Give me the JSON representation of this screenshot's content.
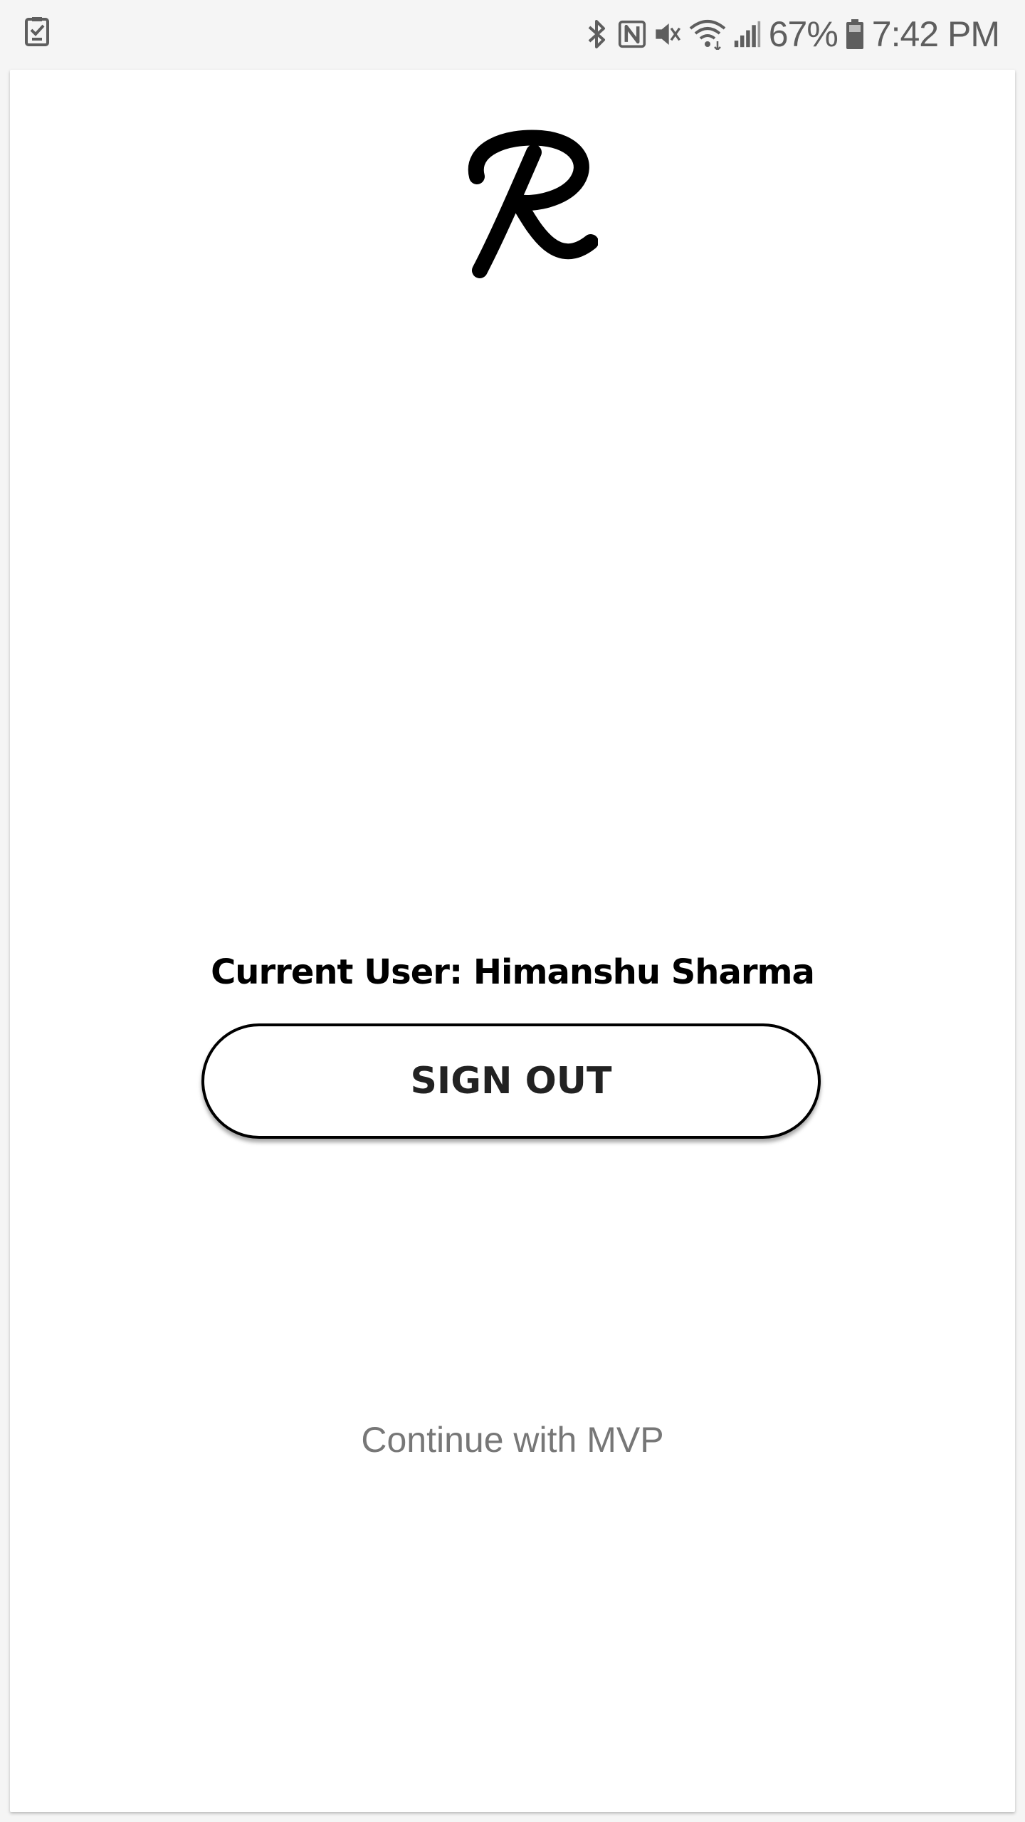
{
  "status_bar": {
    "battery_percent": "67%",
    "time": "7:42 PM",
    "icons": [
      "task-notification-icon",
      "bluetooth-icon",
      "nfc-icon",
      "vibrate-mute-icon",
      "wifi-icon",
      "signal-icon",
      "battery-icon"
    ]
  },
  "app": {
    "logo_icon": "script-r-logo",
    "current_user_text": "Current User: Himanshu Sharma",
    "sign_out_label": "SIGN OUT",
    "continue_label": "Continue with MVP"
  },
  "colors": {
    "background": "#ffffff",
    "status_bar_bg": "#f5f5f5",
    "text_primary": "#000000",
    "link_text": "#777777"
  }
}
